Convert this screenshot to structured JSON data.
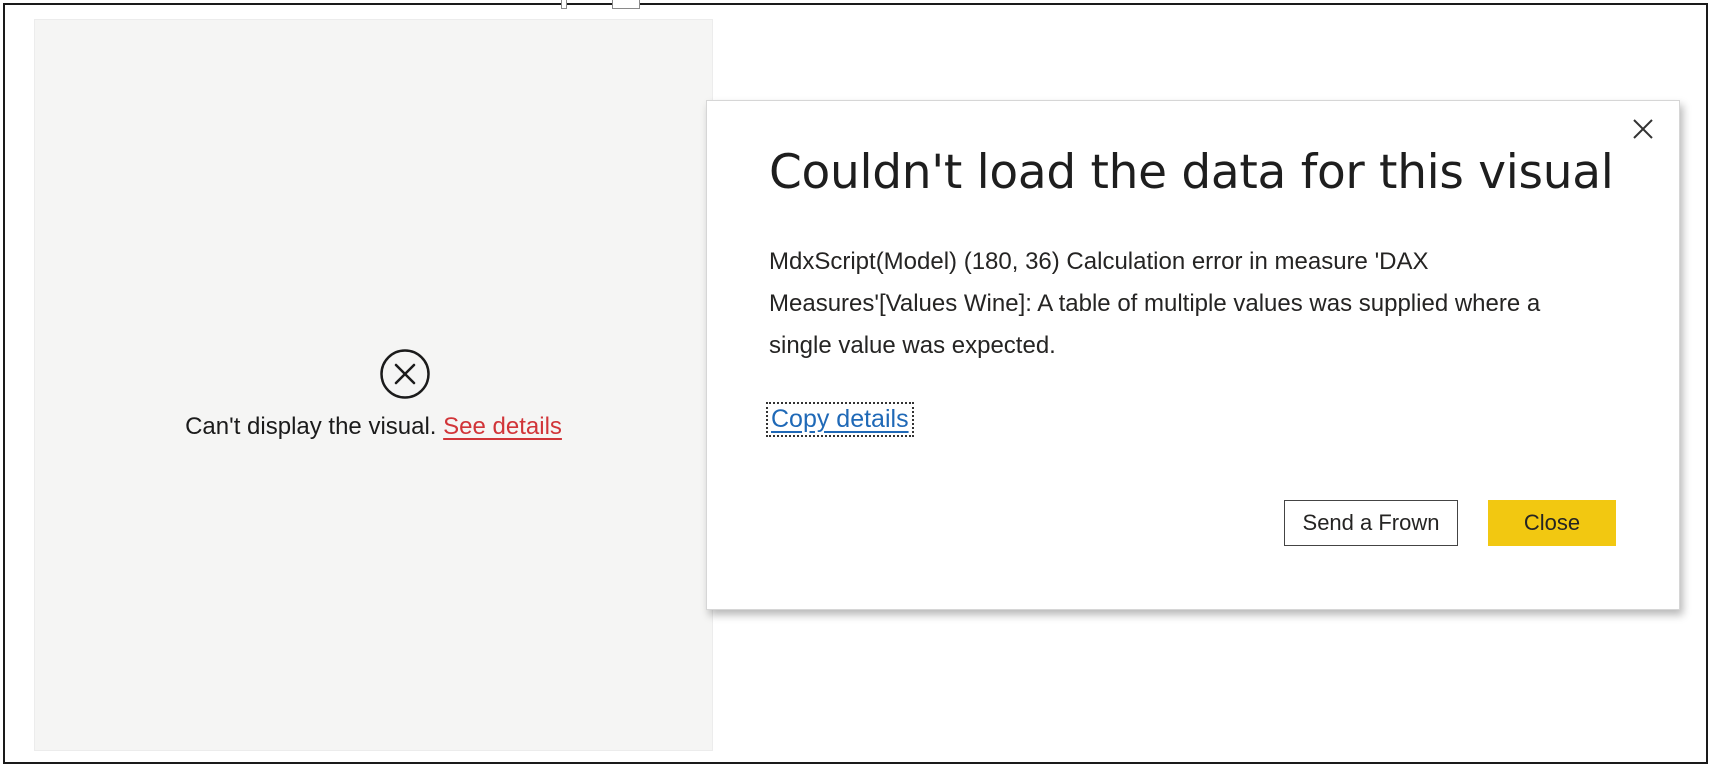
{
  "visual": {
    "error_text": "Can't display the visual.",
    "see_details_link": "See details",
    "error_icon": "circle-x-icon"
  },
  "dialog": {
    "title": "Couldn't load the data for this visual",
    "message": "MdxScript(Model) (180, 36) Calculation error in measure 'DAX Measures'[Values Wine]: A table of multiple values was supplied where a single value was expected.",
    "copy_details_link": "Copy details",
    "close_icon": "close-icon",
    "buttons": {
      "send_frown": "Send a Frown",
      "close": "Close"
    }
  },
  "colors": {
    "accent_button": "#f2c811",
    "error_link": "#d13438",
    "link": "#1f69b7",
    "panel_background": "#f5f5f4"
  }
}
